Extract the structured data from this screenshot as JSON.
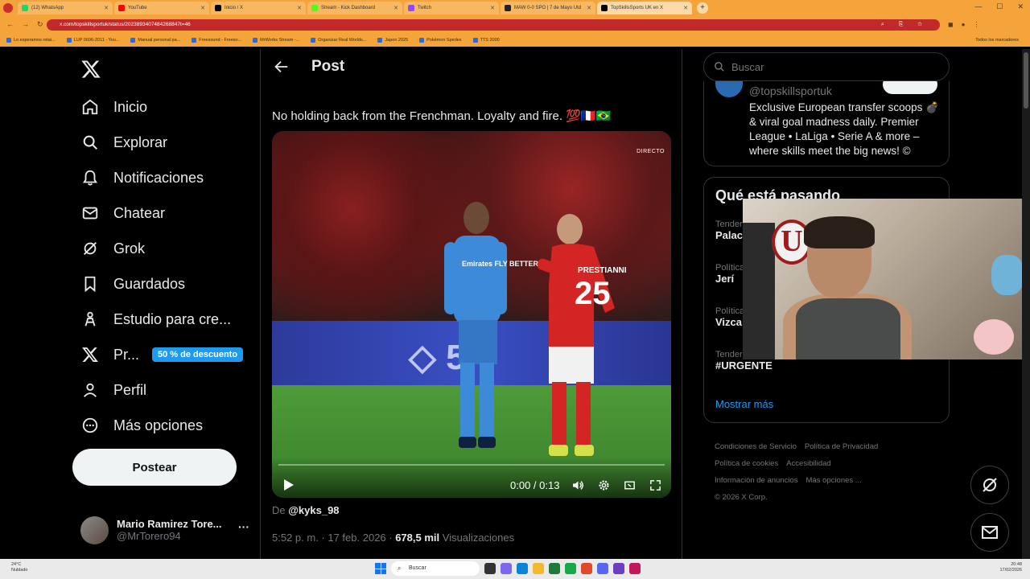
{
  "browser": {
    "tabs": [
      {
        "label": "(12) WhatsApp",
        "color": "#25d366",
        "active": false
      },
      {
        "label": "YouTube",
        "color": "#ff0000",
        "active": false
      },
      {
        "label": "Inicio / X",
        "color": "#000000",
        "active": false
      },
      {
        "label": "Stream - Kick Dashboard",
        "color": "#53fc18",
        "active": false
      },
      {
        "label": "Twitch",
        "color": "#9146ff",
        "active": false
      },
      {
        "label": "MAW 0-0 SPO | 7 de Mayo Utd",
        "color": "#222222",
        "active": false
      },
      {
        "label": "TopSkillsSports UK en X",
        "color": "#000000",
        "active": true
      }
    ],
    "url": "x.com/topskillsportuk/status/2023893407484268847t=46",
    "bookmarks": [
      "Lo esperamos retai...",
      "LUP 0606-2011 - You...",
      "Manual personal pa...",
      "Freesound - Freeso...",
      "MrWorks Stream -...",
      "Organizar Real Worlds...",
      "Japon 2025",
      "Pokémon Spedes",
      "TTS 2000"
    ],
    "bookmarks_right": "Todos los marcadores"
  },
  "nav": {
    "items": [
      {
        "label": "Inicio",
        "icon": "home-icon"
      },
      {
        "label": "Explorar",
        "icon": "search-icon"
      },
      {
        "label": "Notificaciones",
        "icon": "bell-icon"
      },
      {
        "label": "Chatear",
        "icon": "mail-icon"
      },
      {
        "label": "Grok",
        "icon": "grok-icon"
      },
      {
        "label": "Guardados",
        "icon": "bookmark-icon"
      },
      {
        "label": "Estudio para cre...",
        "icon": "studio-icon"
      },
      {
        "label": "Pr...",
        "icon": "x-premium-icon"
      },
      {
        "label": "Perfil",
        "icon": "person-icon"
      },
      {
        "label": "Más opciones",
        "icon": "more-circle-icon"
      }
    ],
    "promo_badge": "50 % de descuento",
    "post_button": "Postear",
    "account_name": "Mario Ramirez Tore...",
    "account_handle": "@MrTorero94"
  },
  "post": {
    "header_title": "Post",
    "text": "No holding back from the Frenchman. Loyalty and fire. 💯🇫🇷🇧🇷",
    "video": {
      "live_tag": "DIRECTO",
      "time": "0:00 / 0:13",
      "player_name": "PRESTIANNI",
      "player_number": "25",
      "sponsor": "Emirates FLY BETTER",
      "progress": 0.0
    },
    "from_label": "De",
    "from_user": "@kyks_98",
    "timestamp": "5:52 p. m. · 17 feb. 2026 · ",
    "views_count": "678,5 mil",
    "views_label": " Visualizaciones"
  },
  "right": {
    "search_placeholder": "Buscar",
    "bio_handle": "@topskillsportuk",
    "bio_text": "Exclusive European transfer scoops 💣 & viral goal madness daily. Premier League • LaLiga • Serie A & more – where skills meet the big news! ©",
    "trends_title": "Qué está pasando",
    "trends": [
      {
        "category": "Tender",
        "name": "Palac"
      },
      {
        "category": "Política",
        "name": "Jerí"
      },
      {
        "category": "Política",
        "name": "Vizca"
      },
      {
        "category": "Tender",
        "name": "#URGENTE"
      }
    ],
    "show_more": "Mostrar más",
    "footer": [
      "Condiciones de Servicio",
      "Política de Privacidad",
      "Política de cookies",
      "Accesibilidad",
      "Información de anuncios",
      "Más opciones ...",
      "© 2026 X Corp."
    ]
  },
  "webcam": {
    "badge_letter": "U"
  },
  "taskbar": {
    "weather_temp": "24°C",
    "weather_desc": "Nublado",
    "search": "Buscar",
    "time": "20:48",
    "date": "17/02/2026"
  }
}
